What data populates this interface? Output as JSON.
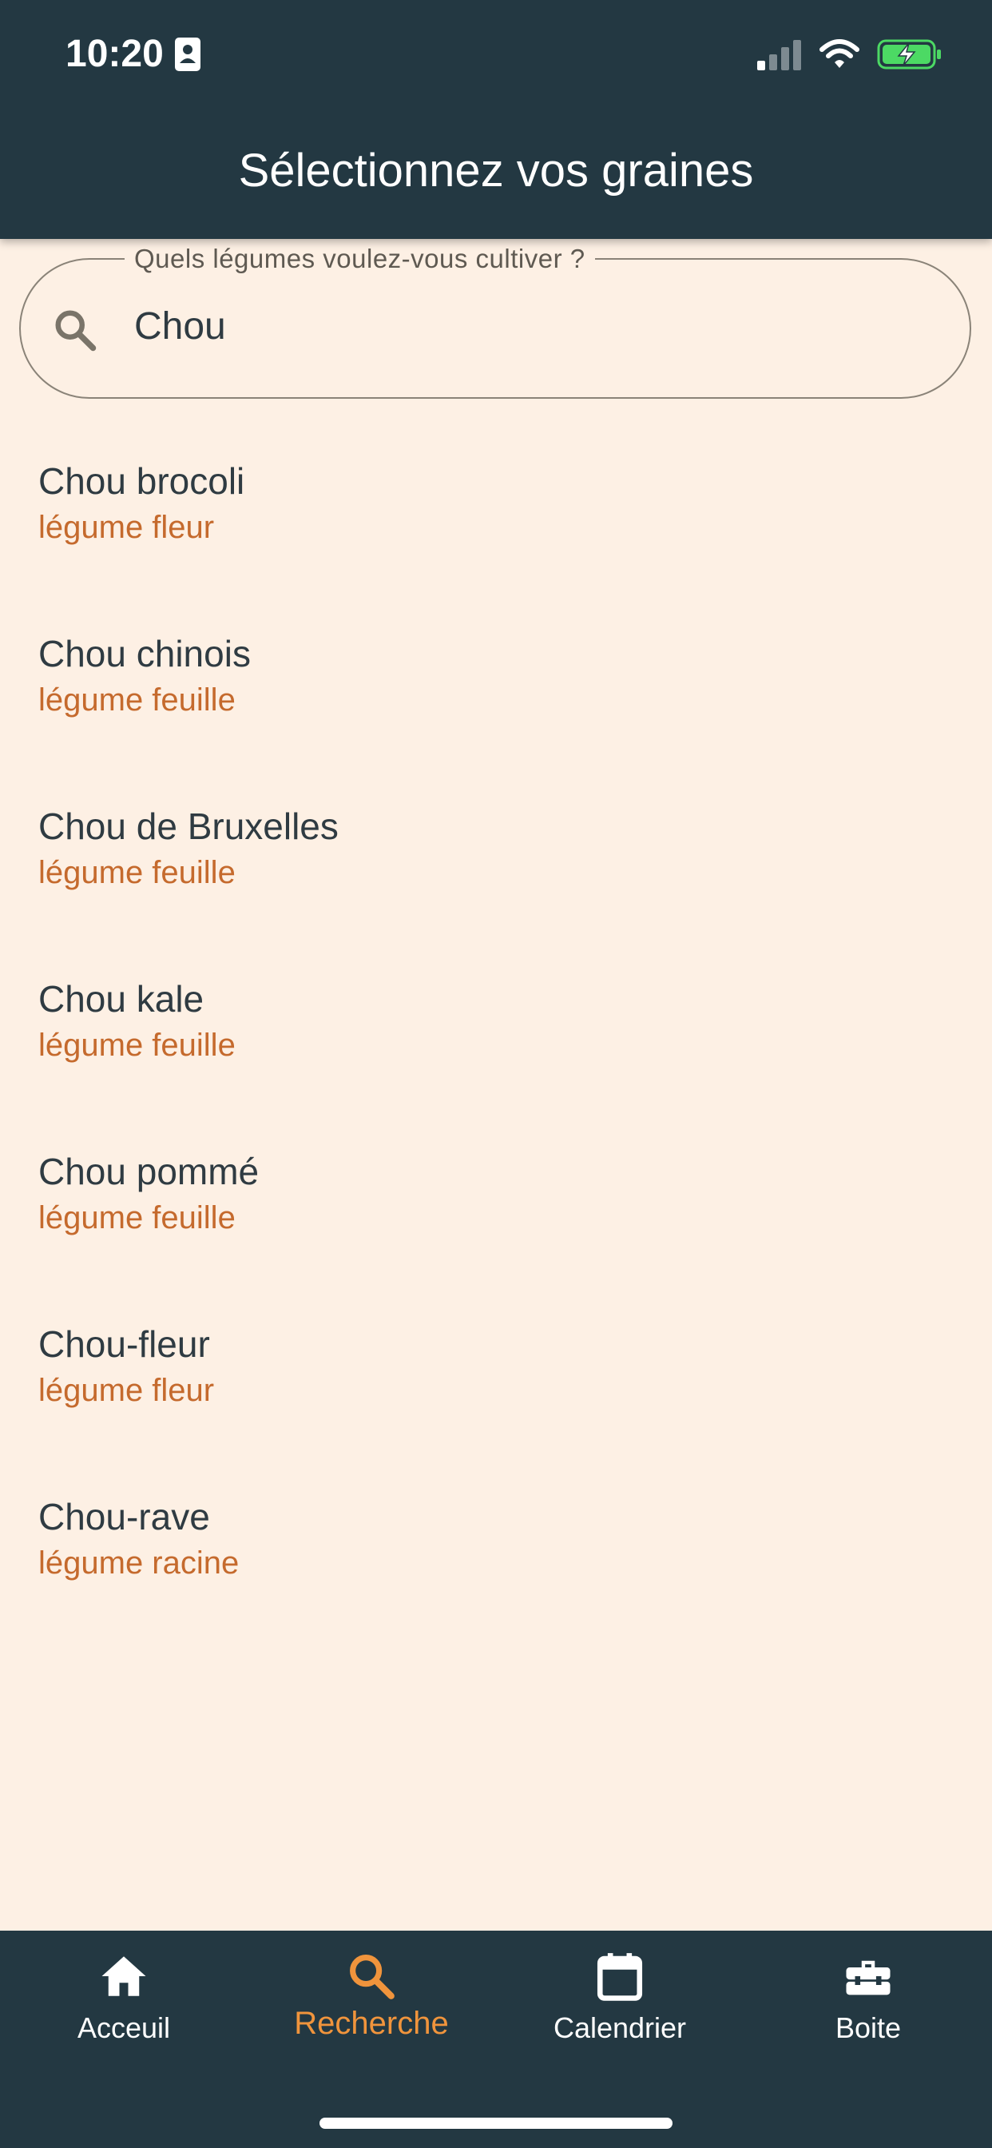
{
  "status_bar": {
    "time": "10:20"
  },
  "header": {
    "title": "Sélectionnez vos graines"
  },
  "search": {
    "label": "Quels légumes voulez-vous cultiver ?",
    "value": "Chou"
  },
  "results": [
    {
      "name": "Chou brocoli",
      "category": "légume fleur"
    },
    {
      "name": "Chou chinois",
      "category": "légume feuille"
    },
    {
      "name": "Chou de Bruxelles",
      "category": "légume feuille"
    },
    {
      "name": "Chou kale",
      "category": "légume feuille"
    },
    {
      "name": "Chou pommé",
      "category": "légume feuille"
    },
    {
      "name": "Chou-fleur",
      "category": "légume fleur"
    },
    {
      "name": "Chou-rave",
      "category": "légume racine"
    }
  ],
  "bottom_nav": {
    "items": [
      {
        "label": "Acceuil",
        "icon": "home-icon"
      },
      {
        "label": "Recherche",
        "icon": "search-icon",
        "active": true
      },
      {
        "label": "Calendrier",
        "icon": "calendar-icon"
      },
      {
        "label": "Boite",
        "icon": "toolbox-icon"
      }
    ]
  },
  "colors": {
    "header_bg": "#233842",
    "page_bg": "#fdf0e4",
    "accent": "#f0943c",
    "category_text": "#c56a2d"
  }
}
